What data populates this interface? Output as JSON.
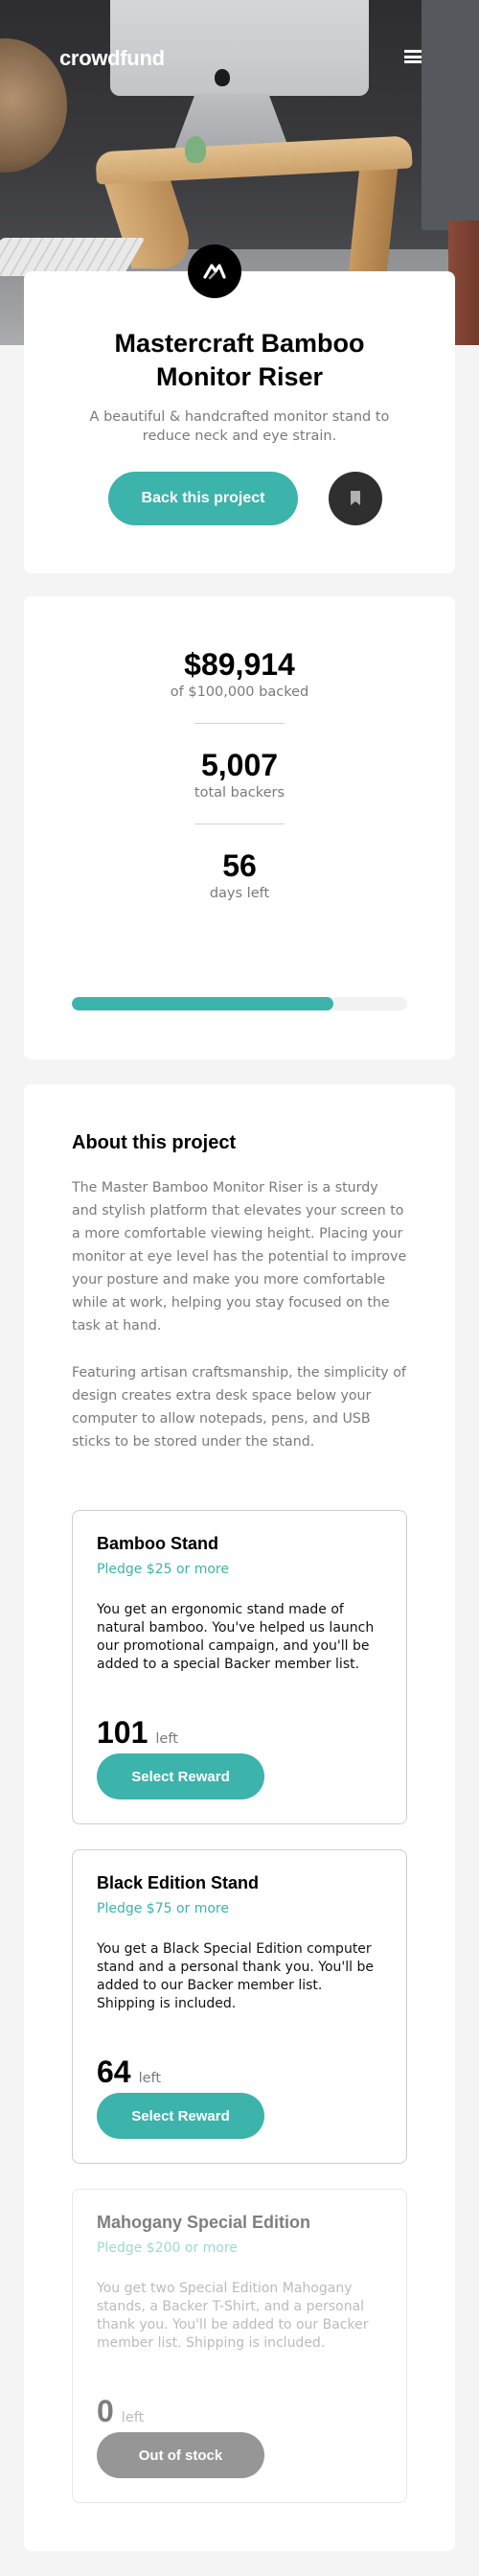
{
  "header": {
    "logo": "crowdfund",
    "menu_icon": "hamburger-menu-icon"
  },
  "project": {
    "badge_icon": "mastercraft-logo-icon",
    "title": "Mastercraft Bamboo Monitor Riser",
    "subtitle": "A beautiful & handcrafted monitor stand to reduce neck and eye strain.",
    "back_label": "Back this project",
    "bookmark_icon": "bookmark-icon"
  },
  "stats": {
    "backed": {
      "value": "$89,914",
      "label": "of $100,000 backed"
    },
    "backers": {
      "value": "5,007",
      "label": "total backers"
    },
    "days": {
      "value": "56",
      "label": "days left"
    },
    "progress_fraction": 0.78
  },
  "about": {
    "title": "About this project",
    "paragraphs": [
      "The Master Bamboo Monitor Riser is a sturdy and stylish platform that elevates your screen to a more comfortable viewing height. Placing your monitor at eye level has the potential to improve your posture and make you more comfortable while at work, helping you stay focused on the task at hand.",
      "Featuring artisan craftsmanship, the simplicity of design creates extra desk space below your computer to allow notepads, pens, and USB sticks to be stored under the stand."
    ]
  },
  "rewards": [
    {
      "name": "Bamboo Stand",
      "pledge": "Pledge $25 or more",
      "description": "You get an ergonomic stand made of natural bamboo. You've helped us launch our promotional campaign, and you'll be added to a special Backer member list.",
      "count": "101",
      "left_label": "left",
      "button": "Select Reward"
    },
    {
      "name": "Black Edition Stand",
      "pledge": "Pledge $75 or more",
      "description": "You get a Black Special Edition computer stand and a personal thank you. You'll be added to our Backer member list. Shipping is included.",
      "count": "64",
      "left_label": "left",
      "button": "Select Reward"
    },
    {
      "name": "Mahogany Special Edition",
      "pledge": "Pledge $200 or more",
      "description": "You get two Special Edition Mahogany stands, a Backer T-Shirt, and a personal thank you. You'll be added to our Backer member list. Shipping is included.",
      "count": "0",
      "left_label": "left",
      "button": "Out of stock"
    }
  ],
  "colors": {
    "accent": "#3cb3ab",
    "dark": "#2f2f2f",
    "muted_text": "#7a7a7a",
    "background": "#f4f4f4"
  }
}
